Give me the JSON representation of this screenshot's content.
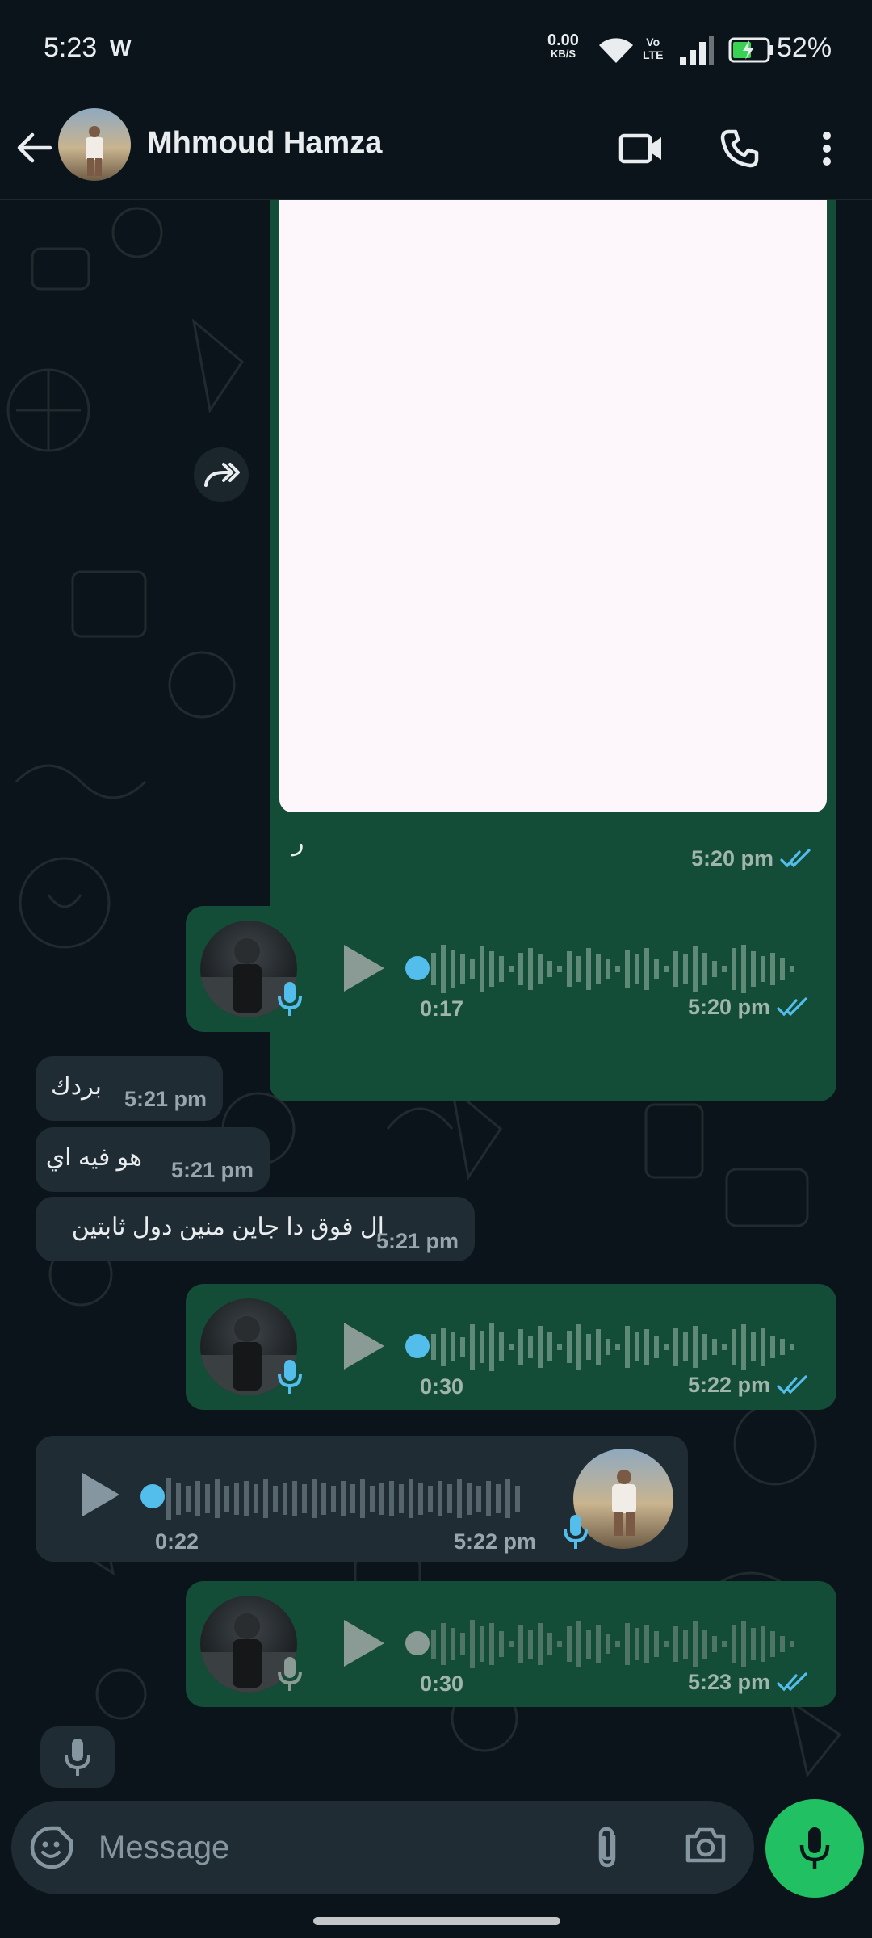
{
  "status_bar": {
    "time": "5:23",
    "w_icon": "W",
    "speed": "0.00",
    "speed_unit": "KB/S",
    "volte_top": "Vo",
    "volte_bottom": "LTE",
    "battery": "52%"
  },
  "header": {
    "contact_name": "Mhmoud Hamza",
    "icons": [
      "back-arrow-icon",
      "video-call-icon",
      "phone-icon",
      "more-vert-icon"
    ]
  },
  "messages": {
    "image": {
      "caption": "ر",
      "time": "5:20 pm",
      "status": "read"
    },
    "voice1": {
      "duration": "0:17",
      "time": "5:20 pm",
      "status": "read"
    },
    "text1": {
      "text": "بردك",
      "time": "5:21 pm"
    },
    "text2": {
      "text": "هو فيه اي",
      "time": "5:21 pm"
    },
    "text3": {
      "text": "ال فوق دا جاين منين دول ثابتين",
      "time": "5:21 pm"
    },
    "voice2": {
      "duration": "0:30",
      "time": "5:22 pm",
      "status": "read"
    },
    "voice_in": {
      "duration": "0:22",
      "time": "5:22 pm"
    },
    "voice3": {
      "duration": "0:30",
      "time": "5:23 pm",
      "status": "read"
    }
  },
  "input": {
    "placeholder": "Message"
  },
  "colors": {
    "background": "#0b141a",
    "outgoing_bubble": "#144d37",
    "incoming_bubble": "#1f2c34",
    "accent_green": "#21c063",
    "read_ticks": "#53bdeb"
  }
}
